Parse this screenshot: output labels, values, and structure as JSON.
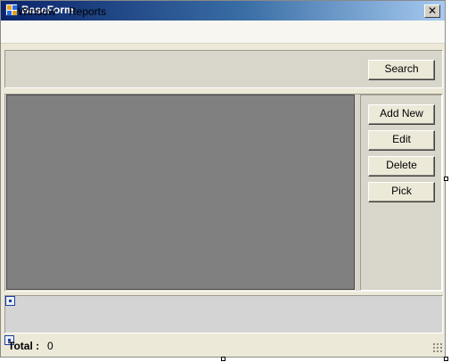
{
  "window": {
    "title": "BaseForm",
    "close_glyph": "✕"
  },
  "menu": {
    "items": [
      {
        "label": "Window"
      },
      {
        "label": "Reports"
      }
    ]
  },
  "search": {
    "button_label": "Search"
  },
  "actions": {
    "add_new": "Add New",
    "edit": "Edit",
    "delete": "Delete",
    "pick": "Pick"
  },
  "status": {
    "total_label": "Total :",
    "total_value": "0"
  },
  "icons": {
    "app": "application-icon",
    "close": "close-icon",
    "component_1": "component-icon",
    "component_2": "component-icon",
    "resize": "resize-grip-icon"
  },
  "colors": {
    "titlebar_start": "#0a246a",
    "titlebar_end": "#a6caf0",
    "grid_background": "#808080",
    "window_face": "#ece9d8"
  }
}
